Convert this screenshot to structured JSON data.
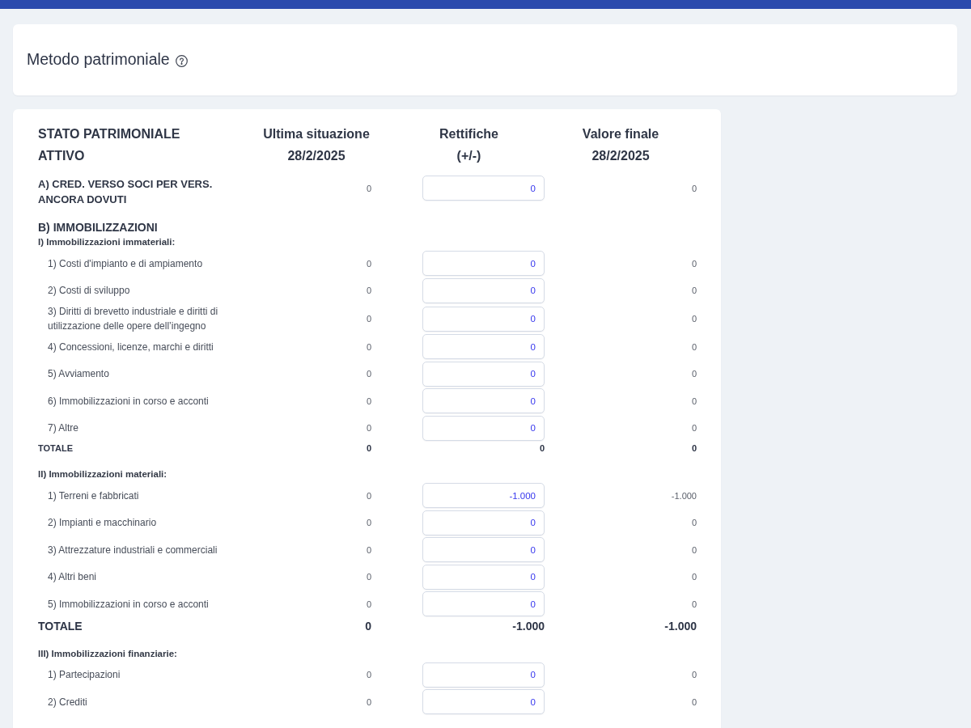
{
  "header": {
    "title": "Metodo patrimoniale"
  },
  "table": {
    "columns": [
      {
        "title": "STATO PATRIMONIALE",
        "subtitle": "ATTIVO"
      },
      {
        "title": "Ultima situazione",
        "subtitle": "28/2/2025"
      },
      {
        "title": "Rettifiche",
        "subtitle": "(+/-)"
      },
      {
        "title": "Valore finale",
        "subtitle": "28/2/2025"
      }
    ],
    "sections": [
      {
        "label": "A) CRED. VERSO SOCI PER VERS. ANCORA DOVUTI",
        "last": "0",
        "adjustment": "0",
        "final": "0"
      },
      {
        "label": "B) IMMOBILIZZAZIONI",
        "children": [
          {
            "label": "I) Immobilizzazioni immateriali:",
            "children": [
              {
                "label": "1) Costi d'impianto e di ampiamento",
                "last": "0",
                "adjustment": "0",
                "final": "0"
              },
              {
                "label": "2) Costi di sviluppo",
                "last": "0",
                "adjustment": "0",
                "final": "0"
              },
              {
                "label": "3) Diritti di brevetto industriale e diritti di utilizzazione delle opere dell’ingegno",
                "last": "0",
                "adjustment": "0",
                "final": "0"
              },
              {
                "label": "4) Concessioni, licenze, marchi e diritti",
                "last": "0",
                "adjustment": "0",
                "final": "0"
              },
              {
                "label": "5) Avviamento",
                "last": "0",
                "adjustment": "0",
                "final": "0"
              },
              {
                "label": "6) Immobilizzazioni in corso e acconti",
                "last": "0",
                "adjustment": "0",
                "final": "0"
              },
              {
                "label": "7) Altre",
                "last": "0",
                "adjustment": "0",
                "final": "0"
              }
            ],
            "total": {
              "kind": "minor",
              "label": "TOTALE",
              "last": "0",
              "adjustment": "0",
              "final": "0"
            }
          },
          {
            "label": "II) Immobilizzazioni materiali:",
            "children": [
              {
                "label": "1) Terreni e fabbricati",
                "last": "0",
                "adjustment": "-1.000",
                "final": "-1.000"
              },
              {
                "label": "2) Impianti e macchinario",
                "last": "0",
                "adjustment": "0",
                "final": "0"
              },
              {
                "label": "3) Attrezzature industriali e commerciali",
                "last": "0",
                "adjustment": "0",
                "final": "0"
              },
              {
                "label": "4) Altri beni",
                "last": "0",
                "adjustment": "0",
                "final": "0"
              },
              {
                "label": "5) Immobilizzazioni in corso e acconti",
                "last": "0",
                "adjustment": "0",
                "final": "0"
              }
            ],
            "total": {
              "kind": "major",
              "label": "TOTALE",
              "last": "0",
              "adjustment": "-1.000",
              "final": "-1.000"
            }
          },
          {
            "label": "III) Immobilizzazioni finanziarie:",
            "children": [
              {
                "label": "1) Partecipazioni",
                "last": "0",
                "adjustment": "0",
                "final": "0"
              },
              {
                "label": "2) Crediti",
                "last": "0",
                "adjustment": "0",
                "final": "0"
              }
            ]
          }
        ]
      }
    ]
  }
}
